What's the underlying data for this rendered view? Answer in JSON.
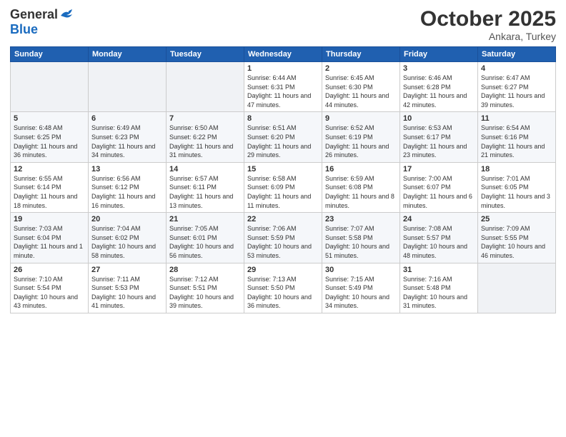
{
  "logo": {
    "general": "General",
    "blue": "Blue"
  },
  "title": "October 2025",
  "subtitle": "Ankara, Turkey",
  "days_header": [
    "Sunday",
    "Monday",
    "Tuesday",
    "Wednesday",
    "Thursday",
    "Friday",
    "Saturday"
  ],
  "weeks": [
    [
      {
        "num": "",
        "info": ""
      },
      {
        "num": "",
        "info": ""
      },
      {
        "num": "",
        "info": ""
      },
      {
        "num": "1",
        "info": "Sunrise: 6:44 AM\nSunset: 6:31 PM\nDaylight: 11 hours\nand 47 minutes."
      },
      {
        "num": "2",
        "info": "Sunrise: 6:45 AM\nSunset: 6:30 PM\nDaylight: 11 hours\nand 44 minutes."
      },
      {
        "num": "3",
        "info": "Sunrise: 6:46 AM\nSunset: 6:28 PM\nDaylight: 11 hours\nand 42 minutes."
      },
      {
        "num": "4",
        "info": "Sunrise: 6:47 AM\nSunset: 6:27 PM\nDaylight: 11 hours\nand 39 minutes."
      }
    ],
    [
      {
        "num": "5",
        "info": "Sunrise: 6:48 AM\nSunset: 6:25 PM\nDaylight: 11 hours\nand 36 minutes."
      },
      {
        "num": "6",
        "info": "Sunrise: 6:49 AM\nSunset: 6:23 PM\nDaylight: 11 hours\nand 34 minutes."
      },
      {
        "num": "7",
        "info": "Sunrise: 6:50 AM\nSunset: 6:22 PM\nDaylight: 11 hours\nand 31 minutes."
      },
      {
        "num": "8",
        "info": "Sunrise: 6:51 AM\nSunset: 6:20 PM\nDaylight: 11 hours\nand 29 minutes."
      },
      {
        "num": "9",
        "info": "Sunrise: 6:52 AM\nSunset: 6:19 PM\nDaylight: 11 hours\nand 26 minutes."
      },
      {
        "num": "10",
        "info": "Sunrise: 6:53 AM\nSunset: 6:17 PM\nDaylight: 11 hours\nand 23 minutes."
      },
      {
        "num": "11",
        "info": "Sunrise: 6:54 AM\nSunset: 6:16 PM\nDaylight: 11 hours\nand 21 minutes."
      }
    ],
    [
      {
        "num": "12",
        "info": "Sunrise: 6:55 AM\nSunset: 6:14 PM\nDaylight: 11 hours\nand 18 minutes."
      },
      {
        "num": "13",
        "info": "Sunrise: 6:56 AM\nSunset: 6:12 PM\nDaylight: 11 hours\nand 16 minutes."
      },
      {
        "num": "14",
        "info": "Sunrise: 6:57 AM\nSunset: 6:11 PM\nDaylight: 11 hours\nand 13 minutes."
      },
      {
        "num": "15",
        "info": "Sunrise: 6:58 AM\nSunset: 6:09 PM\nDaylight: 11 hours\nand 11 minutes."
      },
      {
        "num": "16",
        "info": "Sunrise: 6:59 AM\nSunset: 6:08 PM\nDaylight: 11 hours\nand 8 minutes."
      },
      {
        "num": "17",
        "info": "Sunrise: 7:00 AM\nSunset: 6:07 PM\nDaylight: 11 hours\nand 6 minutes."
      },
      {
        "num": "18",
        "info": "Sunrise: 7:01 AM\nSunset: 6:05 PM\nDaylight: 11 hours\nand 3 minutes."
      }
    ],
    [
      {
        "num": "19",
        "info": "Sunrise: 7:03 AM\nSunset: 6:04 PM\nDaylight: 11 hours\nand 1 minute."
      },
      {
        "num": "20",
        "info": "Sunrise: 7:04 AM\nSunset: 6:02 PM\nDaylight: 10 hours\nand 58 minutes."
      },
      {
        "num": "21",
        "info": "Sunrise: 7:05 AM\nSunset: 6:01 PM\nDaylight: 10 hours\nand 56 minutes."
      },
      {
        "num": "22",
        "info": "Sunrise: 7:06 AM\nSunset: 5:59 PM\nDaylight: 10 hours\nand 53 minutes."
      },
      {
        "num": "23",
        "info": "Sunrise: 7:07 AM\nSunset: 5:58 PM\nDaylight: 10 hours\nand 51 minutes."
      },
      {
        "num": "24",
        "info": "Sunrise: 7:08 AM\nSunset: 5:57 PM\nDaylight: 10 hours\nand 48 minutes."
      },
      {
        "num": "25",
        "info": "Sunrise: 7:09 AM\nSunset: 5:55 PM\nDaylight: 10 hours\nand 46 minutes."
      }
    ],
    [
      {
        "num": "26",
        "info": "Sunrise: 7:10 AM\nSunset: 5:54 PM\nDaylight: 10 hours\nand 43 minutes."
      },
      {
        "num": "27",
        "info": "Sunrise: 7:11 AM\nSunset: 5:53 PM\nDaylight: 10 hours\nand 41 minutes."
      },
      {
        "num": "28",
        "info": "Sunrise: 7:12 AM\nSunset: 5:51 PM\nDaylight: 10 hours\nand 39 minutes."
      },
      {
        "num": "29",
        "info": "Sunrise: 7:13 AM\nSunset: 5:50 PM\nDaylight: 10 hours\nand 36 minutes."
      },
      {
        "num": "30",
        "info": "Sunrise: 7:15 AM\nSunset: 5:49 PM\nDaylight: 10 hours\nand 34 minutes."
      },
      {
        "num": "31",
        "info": "Sunrise: 7:16 AM\nSunset: 5:48 PM\nDaylight: 10 hours\nand 31 minutes."
      },
      {
        "num": "",
        "info": ""
      }
    ]
  ]
}
